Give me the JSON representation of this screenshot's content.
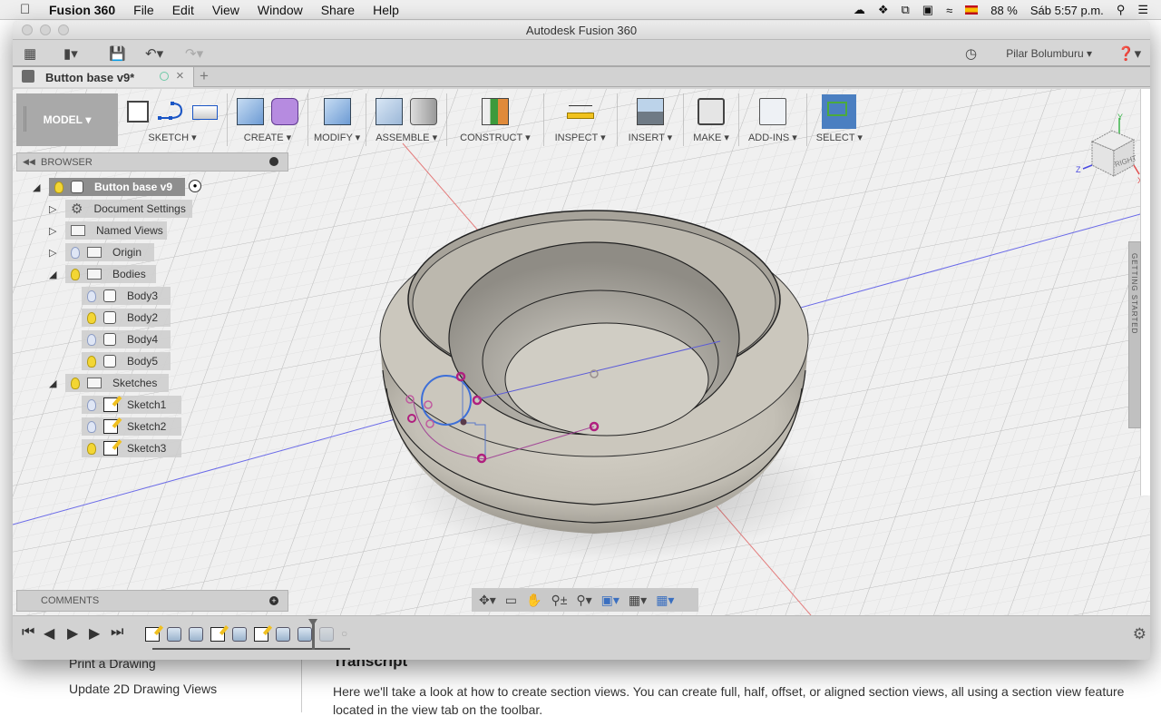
{
  "menubar": {
    "apple_icon": "apple-logo-icon",
    "app_name": "Fusion 360",
    "items": [
      "File",
      "Edit",
      "View",
      "Window",
      "Share",
      "Help"
    ],
    "status_icons": [
      "creative-cloud-icon",
      "dropbox-icon",
      "sync-icon",
      "bluetooth-camera-icon",
      "wifi-icon",
      "spanish-flag-input-icon"
    ],
    "battery": "88 %",
    "clock": "Sáb 5:57 p.m.",
    "search_icon": "spotlight-search-icon",
    "list_icon": "notification-center-icon"
  },
  "window": {
    "title": "Autodesk Fusion 360"
  },
  "app_toolbar": {
    "user": "Pilar Bolumburu",
    "icons": [
      "data-panel-grid-icon",
      "file-icon",
      "save-icon",
      "undo-icon",
      "redo-icon",
      "job-status-clock-icon",
      "help-icon"
    ]
  },
  "document_tab": {
    "name": "Button base v9*",
    "new_tab": "+"
  },
  "ribbon": {
    "workspace": "MODEL",
    "groups": [
      {
        "label": "SKETCH",
        "icons": [
          "create-sketch-icon",
          "spline-icon",
          "rectangle-icon"
        ]
      },
      {
        "label": "CREATE",
        "icons": [
          "extrude-icon",
          "form-icon"
        ]
      },
      {
        "label": "MODIFY",
        "icons": [
          "press-pull-icon"
        ]
      },
      {
        "label": "ASSEMBLE",
        "icons": [
          "new-component-icon",
          "joint-icon"
        ]
      },
      {
        "label": "CONSTRUCT",
        "icons": [
          "construction-plane-icon"
        ]
      },
      {
        "label": "INSPECT",
        "icons": [
          "measure-icon"
        ]
      },
      {
        "label": "INSERT",
        "icons": [
          "insert-image-icon"
        ]
      },
      {
        "label": "MAKE",
        "icons": [
          "3d-print-icon"
        ]
      },
      {
        "label": "ADD-INS",
        "icons": [
          "scripts-addins-icon"
        ]
      },
      {
        "label": "SELECT",
        "icons": [
          "window-select-icon"
        ]
      }
    ]
  },
  "browser": {
    "title": "BROWSER",
    "root": "Button base v9",
    "nodes": [
      {
        "label": "Document Settings"
      },
      {
        "label": "Named Views"
      },
      {
        "label": "Origin"
      },
      {
        "label": "Bodies"
      },
      {
        "label": "Body3"
      },
      {
        "label": "Body2"
      },
      {
        "label": "Body4"
      },
      {
        "label": "Body5"
      },
      {
        "label": "Sketches"
      },
      {
        "label": "Sketch1"
      },
      {
        "label": "Sketch2"
      },
      {
        "label": "Sketch3"
      }
    ]
  },
  "comments": {
    "title": "COMMENTS"
  },
  "viewcube": {
    "face": "RIGHT",
    "axes": [
      "X",
      "Y",
      "Z"
    ]
  },
  "getting_started": {
    "label": "GETTING STARTED"
  },
  "navbar": {
    "icons": [
      "orbit-icon",
      "look-at-icon",
      "pan-hand-icon",
      "zoom-icon",
      "fit-zoom-window-icon",
      "display-settings-icon",
      "grid-settings-icon",
      "viewports-icon"
    ]
  },
  "timeline": {
    "controls": [
      "go-to-start-icon",
      "step-back-icon",
      "play-icon",
      "step-forward-icon",
      "go-to-end-icon"
    ],
    "items": [
      "sketch",
      "feature",
      "feature",
      "sketch",
      "feature",
      "sketch",
      "feature",
      "feature",
      "feature-suppressed",
      "joint-suppressed"
    ]
  },
  "background_page": {
    "list_items": [
      "Print a Drawing",
      "Update 2D Drawing Views"
    ],
    "heading": "Transcript",
    "paragraph": "Here we'll take a look at how to create section views. You can create full, half, offset, or aligned section views, all using a section view feature located in the view tab on the toolbar."
  },
  "colors": {
    "select_accent": "#4b7fc1",
    "model_button": "#a9a9a9",
    "model_body": "#c9c5bb",
    "sketch_constraint": "#b0207f",
    "axis_x": "#e05050",
    "axis_z": "#5050e0"
  }
}
